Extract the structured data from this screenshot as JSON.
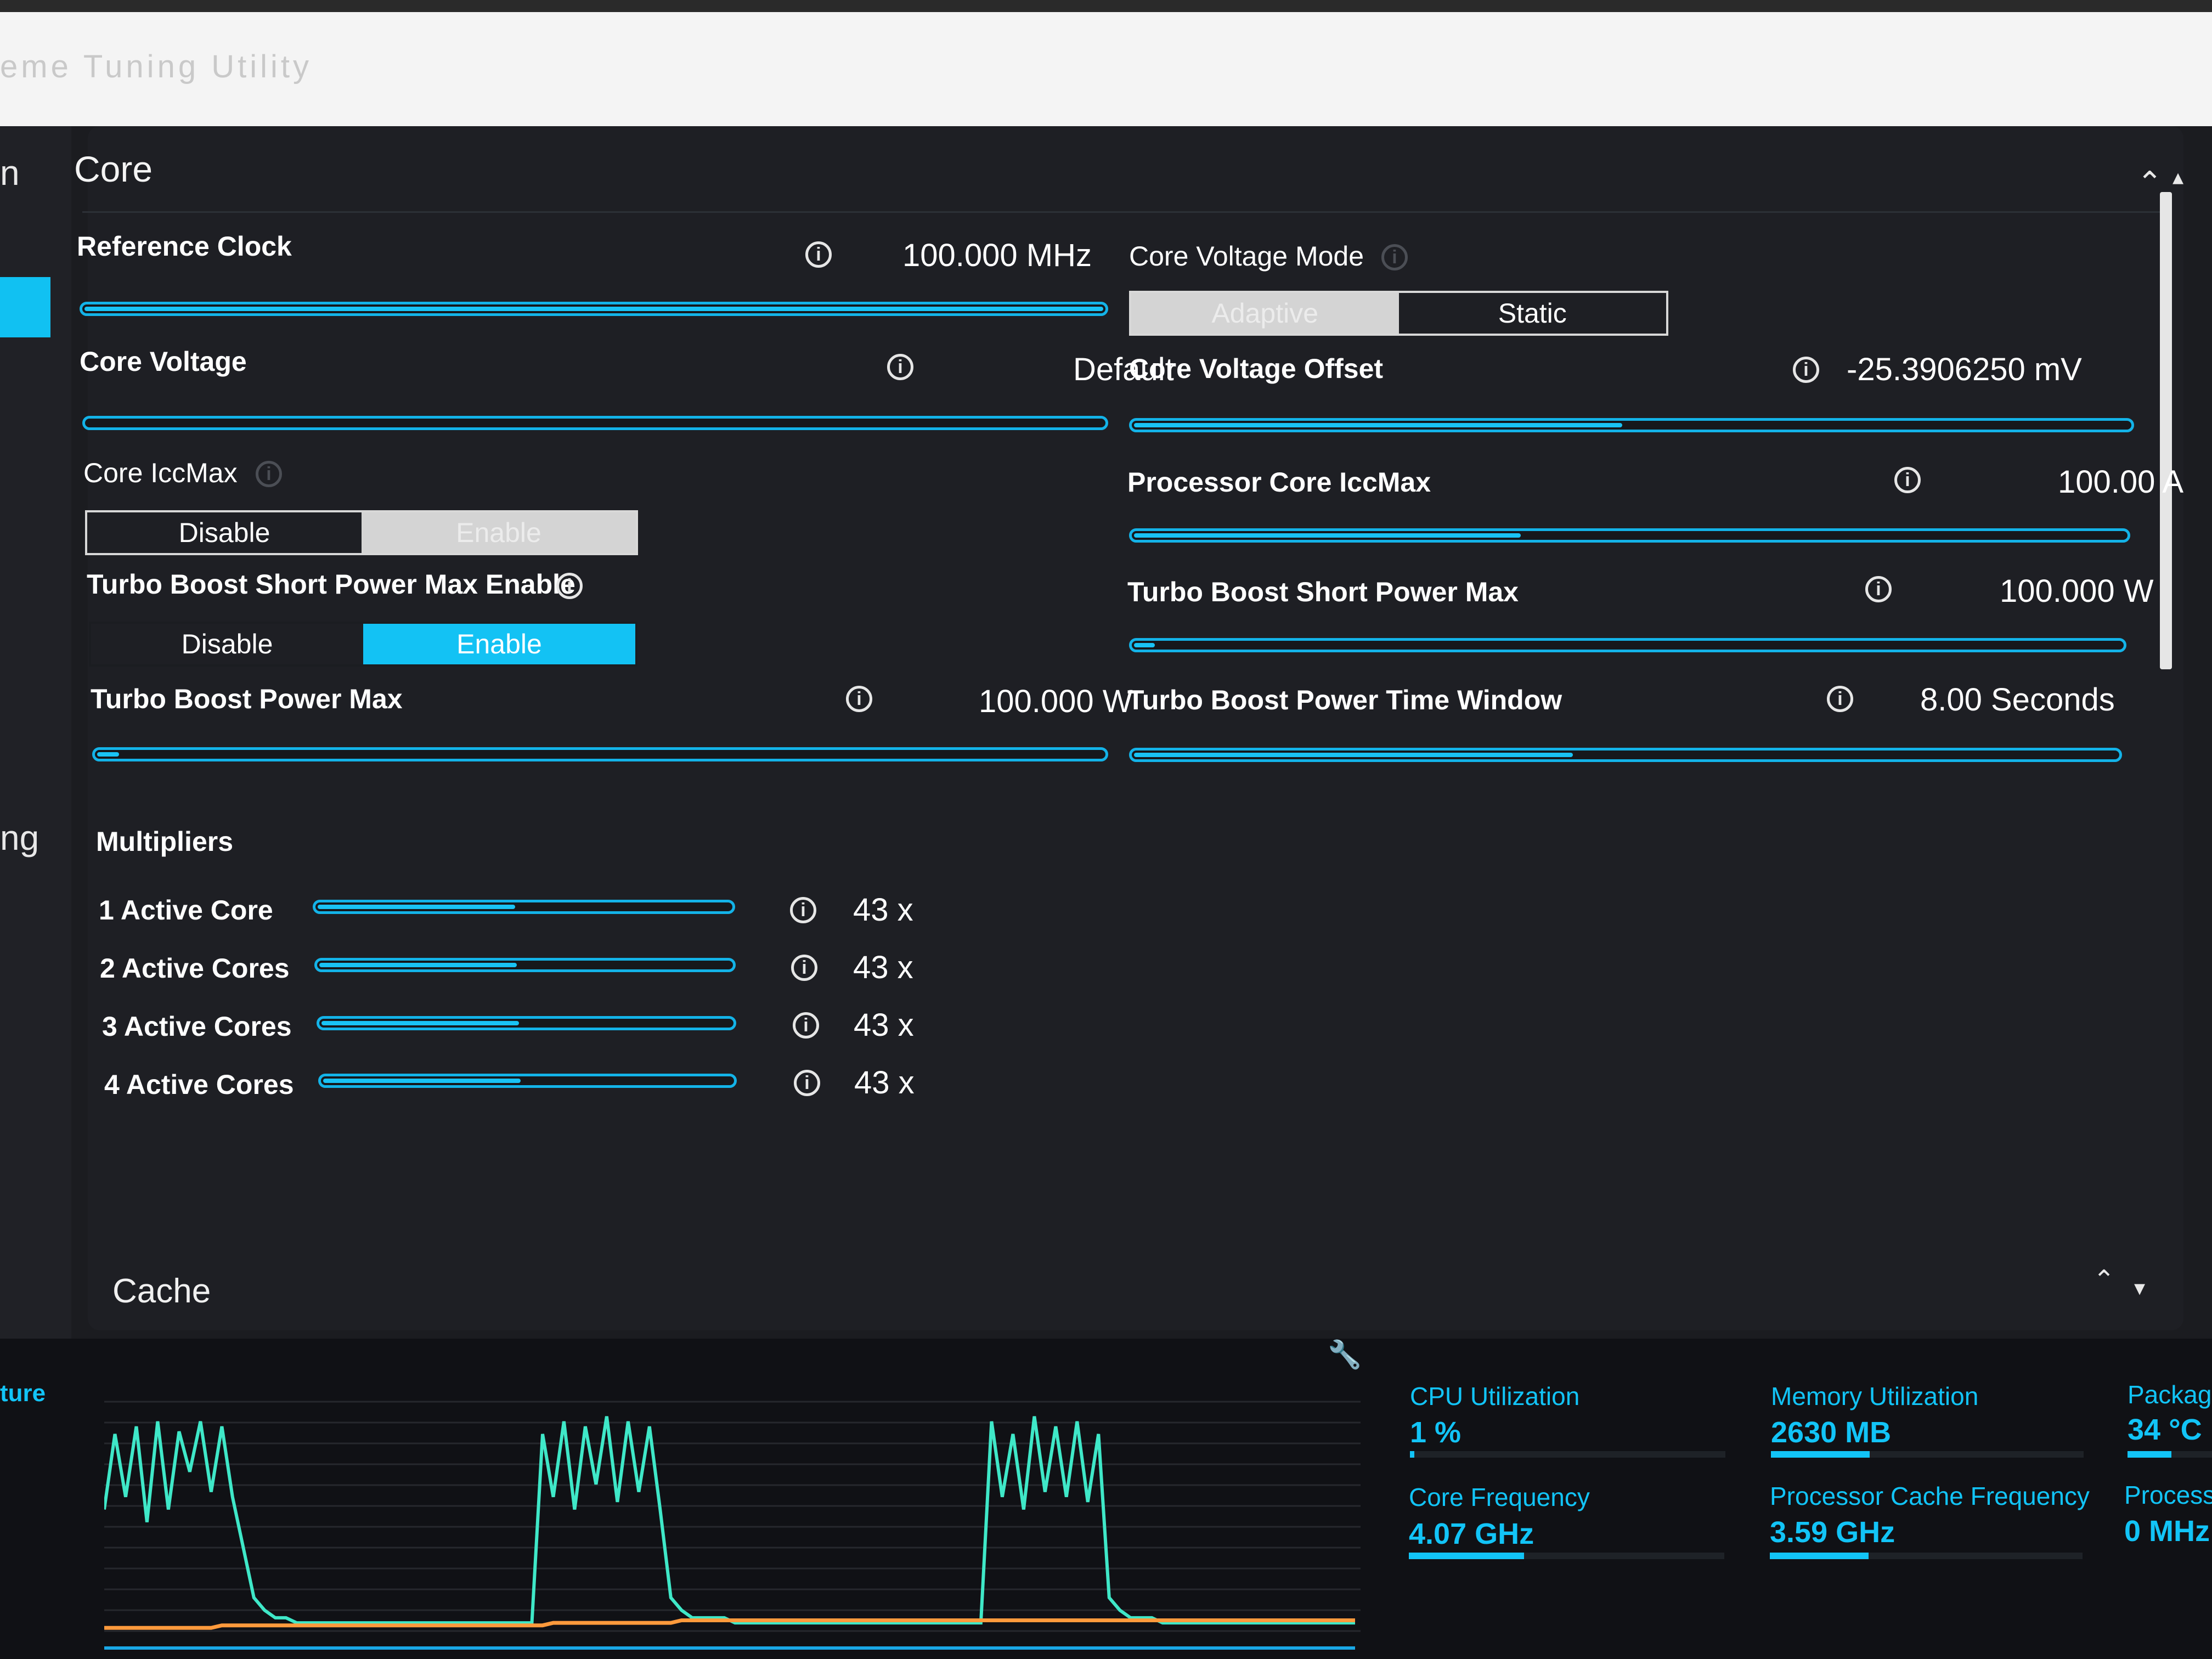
{
  "app": {
    "title": "eme Tuning Utility"
  },
  "nav": {
    "fragment_top": "n",
    "fragment_mid": "ng"
  },
  "section": {
    "title": "Core",
    "next_title": "Cache"
  },
  "reference_clock": {
    "label": "Reference Clock",
    "value": "100.000 MHz",
    "fill": 1.0
  },
  "core_voltage": {
    "label": "Core Voltage",
    "value": "Default",
    "fill": 0.0
  },
  "core_iccmax": {
    "label": "Core IccMax",
    "options": [
      "Disable",
      "Enable"
    ],
    "selected": "Enable"
  },
  "turbo_short_enable": {
    "label": "Turbo Boost Short Power Max Enable",
    "options": [
      "Disable",
      "Enable"
    ],
    "selected": "Enable"
  },
  "turbo_power_max": {
    "label": "Turbo Boost Power Max",
    "value": "100.000 W",
    "fill": 0.02
  },
  "core_voltage_mode": {
    "label": "Core Voltage Mode",
    "options": [
      "Adaptive",
      "Static"
    ],
    "selected": "Adaptive"
  },
  "core_voltage_offset": {
    "label": "Core Voltage Offset",
    "value": "-25.3906250 mV",
    "fill": 0.49
  },
  "processor_core_iccmax": {
    "label": "Processor Core IccMax",
    "value": "100.00 A",
    "fill": 0.39
  },
  "turbo_short_power_max": {
    "label": "Turbo Boost Short Power Max",
    "value": "100.000 W",
    "fill": 0.02
  },
  "turbo_power_time_window": {
    "label": "Turbo Boost Power Time Window",
    "value": "8.00 Seconds",
    "fill": 0.44
  },
  "multipliers": {
    "title": "Multipliers",
    "rows": [
      {
        "label": "1 Active Core",
        "value": "43 x",
        "fill": 0.47
      },
      {
        "label": "2 Active Cores",
        "value": "43 x",
        "fill": 0.47
      },
      {
        "label": "3 Active Cores",
        "value": "43 x",
        "fill": 0.47
      },
      {
        "label": "4 Active Cores",
        "value": "43 x",
        "fill": 0.47
      }
    ]
  },
  "monitor": {
    "left_fragment": "ture",
    "stats": [
      {
        "label": "CPU Utilization",
        "value": "1 %",
        "fill": 0.01
      },
      {
        "label": "Memory Utilization",
        "value": "2630  MB",
        "fill": 0.32
      },
      {
        "label": "Packag",
        "value": "34 °C",
        "fill": 0.3
      },
      {
        "label": "Core Frequency",
        "value": "4.07 GHz",
        "fill": 0.37
      },
      {
        "label": "Processor Cache Frequency",
        "value": "3.59 GHz",
        "fill": 0.32
      },
      {
        "label": "Process",
        "value": "0 MHz",
        "fill": 0.0
      }
    ]
  },
  "chart_data": {
    "type": "line",
    "series": [
      {
        "color": "#3fe8c8",
        "values": [
          55,
          85,
          60,
          88,
          50,
          90,
          55,
          86,
          70,
          90,
          62,
          88,
          60,
          40,
          20,
          15,
          12,
          12,
          10,
          10,
          10,
          10,
          10,
          10,
          10,
          10,
          10,
          10,
          10,
          10,
          10,
          10,
          10,
          10,
          10,
          10,
          10,
          10,
          10,
          10,
          10,
          85,
          60,
          90,
          55,
          88,
          65,
          92,
          58,
          90,
          62,
          88,
          55,
          20,
          15,
          12,
          12,
          12,
          12,
          10,
          10,
          10,
          10,
          10,
          10,
          10,
          10,
          10,
          10,
          10,
          10,
          10,
          10,
          10,
          10,
          10,
          10,
          10,
          10,
          10,
          10,
          10,
          10,
          90,
          60,
          85,
          55,
          92,
          62,
          88,
          60,
          90,
          58,
          85,
          20,
          15,
          12,
          12,
          12,
          10,
          10,
          10,
          10,
          10,
          10,
          10,
          10,
          10,
          10,
          10,
          10,
          10,
          10,
          10,
          10,
          10,
          10,
          10
        ]
      },
      {
        "color": "#ff9a3c",
        "values": [
          8,
          8,
          8,
          8,
          8,
          8,
          8,
          8,
          8,
          8,
          8,
          9,
          9,
          9,
          9,
          9,
          9,
          9,
          9,
          9,
          9,
          9,
          9,
          9,
          9,
          9,
          9,
          9,
          9,
          9,
          9,
          9,
          9,
          9,
          9,
          9,
          9,
          9,
          9,
          9,
          9,
          9,
          10,
          10,
          10,
          10,
          10,
          10,
          10,
          10,
          10,
          10,
          10,
          10,
          11,
          11,
          11,
          11,
          11,
          11,
          11,
          11,
          11,
          11,
          11,
          11,
          11,
          11,
          11,
          11,
          11,
          11,
          11,
          11,
          11,
          11,
          11,
          11,
          11,
          11,
          11,
          11,
          11,
          11,
          11,
          11,
          11,
          11,
          11,
          11,
          11,
          11,
          11,
          11,
          11,
          11,
          11,
          11,
          11,
          11,
          11,
          11,
          11,
          11,
          11,
          11,
          11,
          11,
          11,
          11,
          11,
          11,
          11,
          11,
          11,
          11,
          11,
          11
        ]
      },
      {
        "color": "#1aa8e6",
        "values": [
          0,
          0,
          0,
          0,
          0,
          0,
          0,
          0,
          0,
          0,
          0,
          0,
          0,
          0,
          0,
          0,
          0,
          0,
          0,
          0,
          0,
          0,
          0,
          0,
          0,
          0,
          0,
          0,
          0,
          0,
          0,
          0,
          0,
          0,
          0,
          0,
          0,
          0,
          0,
          0,
          0,
          0,
          0,
          0,
          0,
          0,
          0,
          0,
          0,
          0,
          0,
          0,
          0,
          0,
          0,
          0,
          0,
          0,
          0,
          0,
          0,
          0,
          0,
          0,
          0,
          0,
          0,
          0,
          0,
          0,
          0,
          0,
          0,
          0,
          0,
          0,
          0,
          0,
          0,
          0,
          0,
          0,
          0,
          0,
          0,
          0,
          0,
          0,
          0,
          0,
          0,
          0,
          0,
          0,
          0,
          0,
          0,
          0,
          0,
          0,
          0,
          0,
          0,
          0,
          0,
          0,
          0,
          0,
          0,
          0,
          0,
          0,
          0,
          0,
          0,
          0,
          0,
          0
        ]
      }
    ],
    "ylim": [
      0,
      100
    ]
  }
}
